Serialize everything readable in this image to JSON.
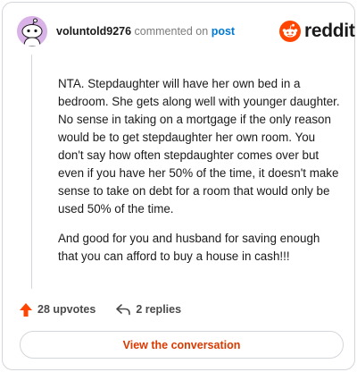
{
  "header": {
    "username": "voluntold9276",
    "action_text": "commented on",
    "post_link": "post",
    "logo_text": "reddit"
  },
  "comment": {
    "paragraphs": [
      "NTA. Stepdaughter will have her own bed in a bedroom. She gets along well with younger daughter. No sense in taking on a mortgage if the only reason would be to get stepdaughter her own room. You don't say how often stepdaughter comes over but even if you have her 50% of the time, it doesn't make sense to take on debt for a room that would only be used 50% of the time.",
      "And good for you and husband for saving enough that you can afford to buy a house in cash!!!"
    ]
  },
  "actions": {
    "upvotes": "28 upvotes",
    "replies": "2 replies"
  },
  "footer": {
    "button_label": "View the conversation"
  },
  "colors": {
    "brand": "#ff4500",
    "link": "#0079d3",
    "button_text": "#d93a00",
    "avatar_bg": "#d9b2e8"
  }
}
